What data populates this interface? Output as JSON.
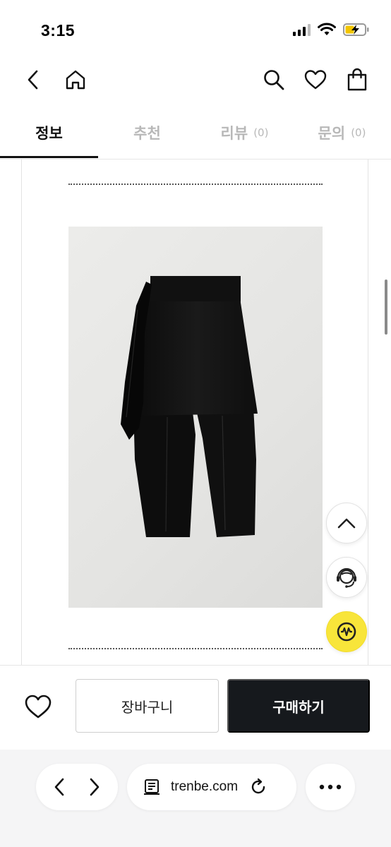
{
  "status_bar": {
    "time": "3:15",
    "icons": [
      "cellular-signal-icon",
      "wifi-icon",
      "battery-charging-icon"
    ]
  },
  "top_nav": {
    "icons": [
      "back-arrow-icon",
      "home-icon",
      "search-icon",
      "heart-icon",
      "shopping-bag-icon"
    ]
  },
  "tabs": [
    {
      "label": "정보",
      "count": "",
      "active": true
    },
    {
      "label": "추천",
      "count": "",
      "active": false
    },
    {
      "label": "리뷰",
      "count": "(0)",
      "active": false
    },
    {
      "label": "문의",
      "count": "(0)",
      "active": false
    }
  ],
  "product": {
    "image_subject": "black pants with attached draped skirt panel"
  },
  "floating_buttons": {
    "icons": [
      "chevron-up-icon",
      "customer-support-icon",
      "waveform-logo-icon"
    ]
  },
  "purchase_bar": {
    "cart_label": "장바구니",
    "buy_label": "구매하기",
    "wishlist_icon": "heart-icon"
  },
  "browser_bar": {
    "url": "trenbe.com",
    "icons": [
      "back-chevron-icon",
      "forward-chevron-icon",
      "page-icon",
      "reload-icon",
      "more-dots-icon"
    ]
  },
  "colors": {
    "accent_yellow": "#f8e53a",
    "buy_button": "#16191d",
    "tab_inactive": "#b8b8b8"
  }
}
